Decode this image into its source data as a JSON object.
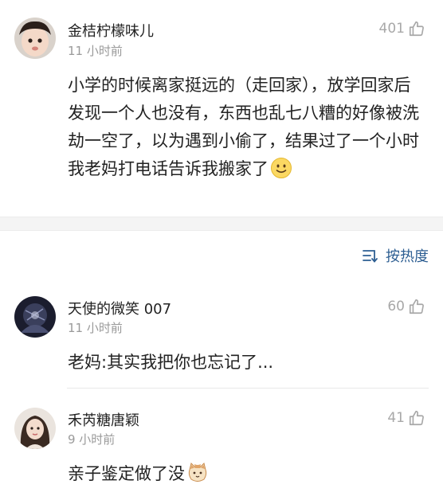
{
  "comments": [
    {
      "username": "金桔柠檬味儿",
      "time": "11 小时前",
      "likes": "401",
      "text": "小学的时候离家挺远的（走回家），放学回家后发现一个人也没有，东西也乱七八糟的好像被洗劫一空了，以为遇到小偷了，结果过了一个小时我老妈打电话告诉我搬家了",
      "emoji": "smile-emoji"
    },
    {
      "username": "天使的微笑 007",
      "time": "11 小时前",
      "likes": "60",
      "text": "老妈:其实我把你也忘记了..."
    },
    {
      "username": "禾芮糖唐颖",
      "time": "9 小时前",
      "likes": "41",
      "text": "亲子鉴定做了没",
      "emoji": "cat-emoji"
    }
  ],
  "sort": {
    "label": "按热度",
    "icon": "sort-icon"
  },
  "icons": {
    "like": "thumbs-up-icon"
  },
  "colors": {
    "link": "#2d5e92",
    "meta": "#9a9a9a",
    "text": "#222222"
  }
}
